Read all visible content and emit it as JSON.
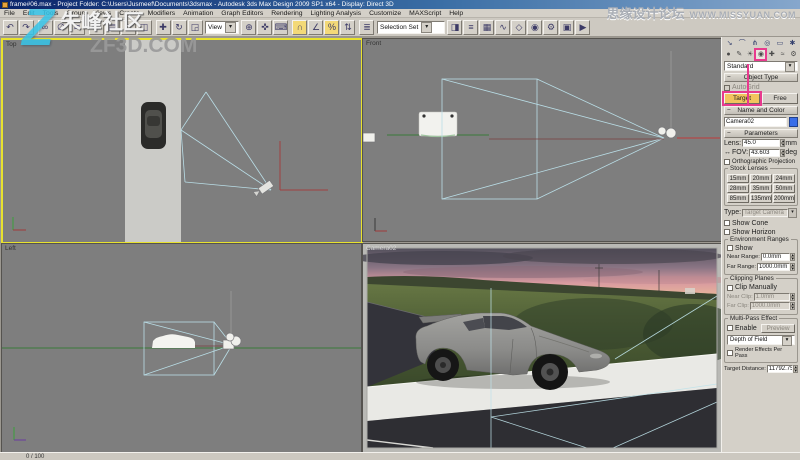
{
  "window": {
    "title": "frame#06.max - Project Folder: C:\\Users\\Jusmeef\\Documents\\3dsmax - Autodesk 3ds Max Design 2009 SP1 x64 - Display: Direct 3D",
    "watermark_left": {
      "logo": "Z",
      "text": "朱峰社区",
      "url": "ZF3D.COM"
    },
    "watermark_right": {
      "cn": "思缘设计论坛",
      "en": "WWW.MISSYUAN.COM"
    }
  },
  "menu": {
    "items": [
      "File",
      "Edit",
      "Tools",
      "Group",
      "Views",
      "Create",
      "Modifiers",
      "Animation",
      "Graph Editors",
      "Rendering",
      "Lighting Analysis",
      "Customize",
      "MAXScript",
      "Help"
    ]
  },
  "toolbar": {
    "view_dropdown": "View",
    "selection_set_dropdown": "Selection Set",
    "dropdown_arrow": "▾",
    "icons": [
      {
        "name": "undo-icon",
        "glyph": "↶"
      },
      {
        "name": "redo-icon",
        "glyph": "↷"
      },
      {
        "name": "select-link-icon",
        "glyph": "∞"
      },
      {
        "name": "unlink-icon",
        "glyph": "∅"
      },
      {
        "name": "bind-spacewarp-icon",
        "glyph": "≋"
      },
      {
        "name": "select-object-icon",
        "glyph": "▭"
      },
      {
        "name": "select-by-name-icon",
        "glyph": "▤"
      },
      {
        "name": "selection-region-icon",
        "glyph": "◻"
      },
      {
        "name": "window-crossing-icon",
        "glyph": "◫"
      },
      {
        "name": "move-icon",
        "glyph": "✚"
      },
      {
        "name": "rotate-icon",
        "glyph": "↻"
      },
      {
        "name": "scale-icon",
        "glyph": "◲"
      },
      {
        "name": "use-center-icon",
        "glyph": "⊕"
      },
      {
        "name": "manipulate-icon",
        "glyph": "✜"
      },
      {
        "name": "keyboard-override-icon",
        "glyph": "⌨"
      },
      {
        "name": "snap-toggle-icon",
        "glyph": "∩",
        "on": true
      },
      {
        "name": "angle-snap-icon",
        "glyph": "∠"
      },
      {
        "name": "percent-snap-icon",
        "glyph": "%",
        "on": true
      },
      {
        "name": "spinner-snap-icon",
        "glyph": "⇅"
      },
      {
        "name": "edit-named-sets-icon",
        "glyph": "≣"
      },
      {
        "name": "mirror-icon",
        "glyph": "◨"
      },
      {
        "name": "align-icon",
        "glyph": "≡"
      },
      {
        "name": "layer-manager-icon",
        "glyph": "▦"
      },
      {
        "name": "curve-editor-icon",
        "glyph": "∿"
      },
      {
        "name": "schematic-view-icon",
        "glyph": "◇"
      },
      {
        "name": "material-editor-icon",
        "glyph": "◉"
      },
      {
        "name": "render-setup-icon",
        "glyph": "⚙"
      },
      {
        "name": "rendered-frame-icon",
        "glyph": "▣"
      },
      {
        "name": "render-icon",
        "glyph": "▶"
      }
    ]
  },
  "viewports": {
    "top": {
      "label": "Top"
    },
    "front": {
      "label": "Front"
    },
    "left": {
      "label": "Left"
    },
    "camera": {
      "label": "Camera02"
    }
  },
  "panel": {
    "tabs": [
      {
        "name": "tab-create-icon",
        "glyph": "↘"
      },
      {
        "name": "tab-modify-icon",
        "glyph": "⌒"
      },
      {
        "name": "tab-hierarchy-icon",
        "glyph": "⋔"
      },
      {
        "name": "tab-motion-icon",
        "glyph": "◎"
      },
      {
        "name": "tab-display-icon",
        "glyph": "▭"
      },
      {
        "name": "tab-utilities-icon",
        "glyph": "✱"
      }
    ],
    "categories": [
      {
        "name": "cat-geometry-icon",
        "glyph": "●"
      },
      {
        "name": "cat-shapes-icon",
        "glyph": "✎"
      },
      {
        "name": "cat-lights-icon",
        "glyph": "☀"
      },
      {
        "name": "cat-cameras-icon",
        "glyph": "◉",
        "highlight": true
      },
      {
        "name": "cat-helpers-icon",
        "glyph": "✚"
      },
      {
        "name": "cat-spacewarps-icon",
        "glyph": "≈"
      },
      {
        "name": "cat-systems-icon",
        "glyph": "⚙"
      }
    ],
    "category_dropdown": "Standard",
    "object_type": {
      "title": "Object Type",
      "autogrid": "AutoGrid",
      "target": "Target",
      "free": "Free"
    },
    "name_color": {
      "title": "Name and Color",
      "name": "Camera02"
    },
    "parameters": {
      "title": "Parameters",
      "lens_label": "Lens:",
      "lens_value": "45.0",
      "lens_unit": "mm",
      "fov_flyout": "↔",
      "fov_label": "FOV:",
      "fov_value": "43.603",
      "fov_unit": "deg",
      "ortho": "Orthographic Projection",
      "stock": {
        "title": "Stock Lenses",
        "buttons": [
          "15mm",
          "20mm",
          "24mm",
          "28mm",
          "35mm",
          "50mm",
          "85mm",
          "135mm",
          "200mm"
        ]
      },
      "type_label": "Type:",
      "type_value": "Target Camera",
      "show_cone": "Show Cone",
      "show_horizon": "Show Horizon",
      "env": {
        "title": "Environment Ranges",
        "show": "Show",
        "near_label": "Near Range:",
        "near_value": "0.0mm",
        "far_label": "Far Range:",
        "far_value": "1000.0mm"
      },
      "clip": {
        "title": "Clipping Planes",
        "manual": "Clip Manually",
        "near_label": "Near Clip:",
        "near_value": "1.0mm",
        "far_label": "Far Clip:",
        "far_value": "1000.0mm"
      },
      "multipass": {
        "title": "Multi-Pass Effect",
        "enable": "Enable",
        "preview": "Preview",
        "effect": "Depth of Field",
        "per_pass": "Render Effects Per Pass"
      },
      "target_distance_label": "Target Distance:",
      "target_distance_value": "11792.75"
    }
  },
  "statusbar": {
    "frames": "0 / 100"
  },
  "colors": {
    "tutorial_highlight": "#e83a8e",
    "active_viewport_border": "#e8e22e",
    "snap_on": "#f3d978",
    "camera_cone": "#b9dde6",
    "object_color_swatch": "#3a6ee8"
  }
}
